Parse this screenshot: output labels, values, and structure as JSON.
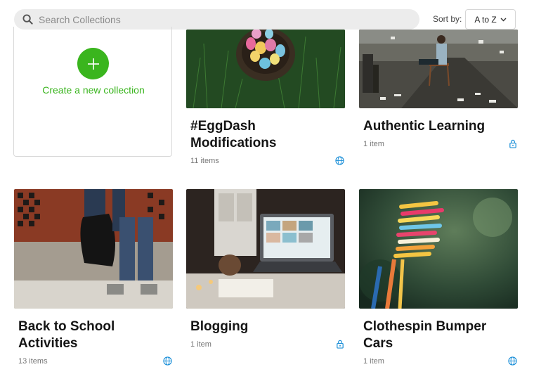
{
  "search": {
    "placeholder": "Search Collections"
  },
  "sort": {
    "label": "Sort by:",
    "value": "A to Z"
  },
  "new_collection": {
    "label": "Create a new collection"
  },
  "collections": [
    {
      "title_lines": [
        "#EggDash",
        "Modifications"
      ],
      "count": "11 items",
      "visibility": "globe-icon"
    },
    {
      "title_lines": [
        "Authentic Learning"
      ],
      "count": "1 item",
      "visibility": "lock-icon"
    },
    {
      "title_lines": [
        "Back to School",
        "Activities"
      ],
      "count": "13 items",
      "visibility": "globe-icon"
    },
    {
      "title_lines": [
        "Blogging"
      ],
      "count": "1 item",
      "visibility": "lock-icon"
    },
    {
      "title_lines": [
        "Clothespin Bumper",
        "Cars"
      ],
      "count": "1 item",
      "visibility": "globe-icon"
    }
  ],
  "colors": {
    "accent_green": "#3ab51e",
    "icon_blue": "#1b8fd8"
  }
}
